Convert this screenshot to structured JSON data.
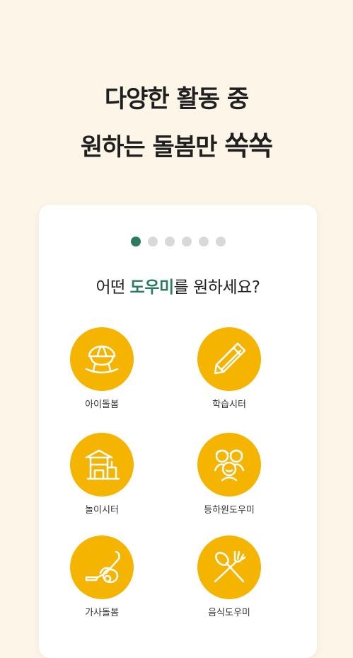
{
  "headline": {
    "line1": "다양한 활동 중",
    "line2_prefix": "원하는 돌봄만 ",
    "line2_emphasis": "쏙쏙"
  },
  "carousel": {
    "total_pages": 6,
    "current_page": 1
  },
  "question": {
    "prefix": "어떤 ",
    "highlight": "도우미",
    "suffix": "를 원하세요?"
  },
  "options": [
    {
      "label": "아이돌봄",
      "icon": "cradle-icon"
    },
    {
      "label": "학습시터",
      "icon": "pencil-icon"
    },
    {
      "label": "놀이시터",
      "icon": "playground-icon"
    },
    {
      "label": "등하원도우미",
      "icon": "children-icon"
    },
    {
      "label": "가사돌봄",
      "icon": "vacuum-cleaner-icon"
    },
    {
      "label": "음식도우미",
      "icon": "spoon-fork-icon"
    }
  ],
  "colors": {
    "background": "#fcf5e8",
    "accent_green": "#2b7a62",
    "icon_yellow": "#f5b400",
    "dot_inactive": "#d9d9d9"
  }
}
